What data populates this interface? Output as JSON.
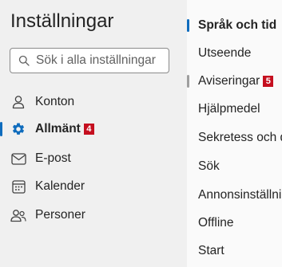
{
  "settings": {
    "title": "Inställningar",
    "search": {
      "placeholder": "Sök i alla inställningar"
    },
    "categories": [
      {
        "label": "Konton",
        "icon": "person-icon",
        "selected": false,
        "badge": ""
      },
      {
        "label": "Allmänt",
        "icon": "gear-icon",
        "selected": true,
        "badge": "4"
      },
      {
        "label": "E-post",
        "icon": "mail-icon",
        "selected": false,
        "badge": ""
      },
      {
        "label": "Kalender",
        "icon": "calendar-icon",
        "selected": false,
        "badge": ""
      },
      {
        "label": "Personer",
        "icon": "people-icon",
        "selected": false,
        "badge": ""
      }
    ],
    "subcategories": [
      {
        "label": "Språk och tid",
        "selected": true,
        "badge": ""
      },
      {
        "label": "Utseende",
        "selected": false,
        "badge": ""
      },
      {
        "label": "Aviseringar",
        "selected": false,
        "badge": "5"
      },
      {
        "label": "Hjälpmedel",
        "selected": false,
        "badge": ""
      },
      {
        "label": "Sekretess och data",
        "selected": false,
        "badge": ""
      },
      {
        "label": "Sök",
        "selected": false,
        "badge": ""
      },
      {
        "label": "Annonsinställningar",
        "selected": false,
        "badge": ""
      },
      {
        "label": "Offline",
        "selected": false,
        "badge": ""
      },
      {
        "label": "Start",
        "selected": false,
        "badge": ""
      }
    ]
  },
  "colors": {
    "accent": "#0f6cbd",
    "badge": "#c50f1f",
    "left_background": "#f0f0f0",
    "right_background": "#fafafa"
  }
}
